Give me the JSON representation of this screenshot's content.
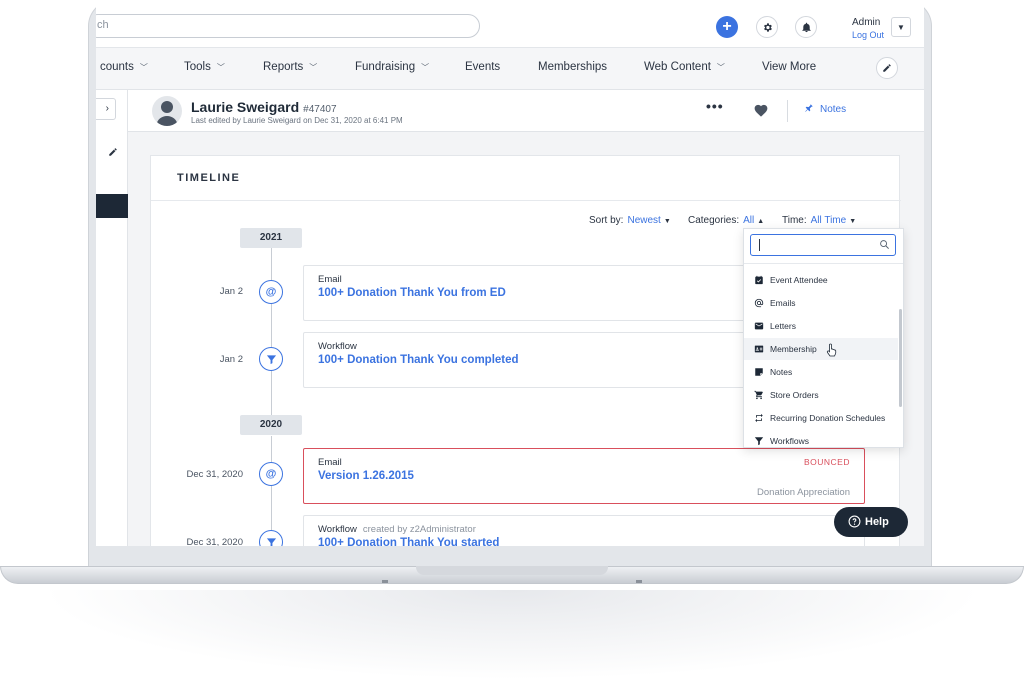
{
  "topbar": {
    "search_placeholder": "ch",
    "admin_name": "Admin",
    "logout_label": "Log Out"
  },
  "nav": {
    "items": [
      "counts",
      "Tools",
      "Reports",
      "Fundraising",
      "Events",
      "Memberships",
      "Web Content",
      "View More"
    ]
  },
  "profile": {
    "name": "Laurie Sweigard",
    "id": "#47407",
    "last_edited": "Last edited by Laurie Sweigard on Dec 31, 2020 at 6:41 PM",
    "more_label": "•••",
    "notes_label": "Notes"
  },
  "timeline": {
    "title": "TIMELINE",
    "sort_label": "Sort by:",
    "sort_value": "Newest",
    "categories_label": "Categories:",
    "categories_value": "All",
    "time_label": "Time:",
    "time_value": "All Time",
    "years": [
      "2021",
      "2020"
    ],
    "entries": [
      {
        "date": "Jan 2",
        "type": "Email",
        "title": "100+ Donation Thank You from ED",
        "icon": "at-icon"
      },
      {
        "date": "Jan 2",
        "type": "Workflow",
        "title": "100+ Donation Thank You completed",
        "icon": "filter-icon"
      },
      {
        "date": "Dec 31, 2020",
        "type": "Email",
        "title": "Version 1.26.2015",
        "status": "BOUNCED",
        "category": "Donation Appreciation",
        "icon": "at-icon"
      },
      {
        "date": "Dec 31, 2020",
        "type": "Workflow",
        "created_by": "created by z2Administrator",
        "title": "100+ Donation Thank You started",
        "icon": "filter-icon"
      }
    ]
  },
  "categories_dropdown": {
    "items": [
      {
        "label": "Event Attendee",
        "icon": "calendar-check-icon"
      },
      {
        "label": "Emails",
        "icon": "at-icon"
      },
      {
        "label": "Letters",
        "icon": "envelope-icon"
      },
      {
        "label": "Membership",
        "icon": "id-card-icon"
      },
      {
        "label": "Notes",
        "icon": "note-icon"
      },
      {
        "label": "Store Orders",
        "icon": "cart-icon"
      },
      {
        "label": "Recurring Donation Schedules",
        "icon": "recurring-icon"
      },
      {
        "label": "Workflows",
        "icon": "filter-icon"
      }
    ],
    "hovered_item": "Membership"
  },
  "help": {
    "label": "Help"
  },
  "colors": {
    "accent": "#3b73e0",
    "danger": "#d94f5c",
    "dark": "#1d2836"
  }
}
